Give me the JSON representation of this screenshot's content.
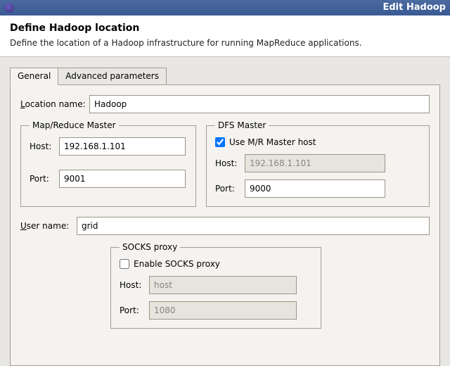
{
  "window": {
    "title": "Edit Hadoop"
  },
  "header": {
    "title": "Define Hadoop location",
    "subtitle": "Define the location of a Hadoop infrastructure for running MapReduce applications."
  },
  "tabs": {
    "general": "General",
    "advanced": "Advanced parameters"
  },
  "form": {
    "location_label": "Location name:",
    "location_value": "Hadoop",
    "mr_legend": "Map/Reduce Master",
    "dfs_legend": "DFS Master",
    "host_label": "Host:",
    "port_label": "Port:",
    "mr_host": "192.168.1.101",
    "mr_port": "9001",
    "use_mr_host_label": "Use M/R Master host",
    "dfs_host": "192.168.1.101",
    "dfs_port": "9000",
    "user_label": "User name:",
    "user_value": "grid",
    "socks_legend": "SOCKS proxy",
    "socks_enable_label": "Enable SOCKS proxy",
    "socks_host_placeholder": "host",
    "socks_port_placeholder": "1080"
  }
}
